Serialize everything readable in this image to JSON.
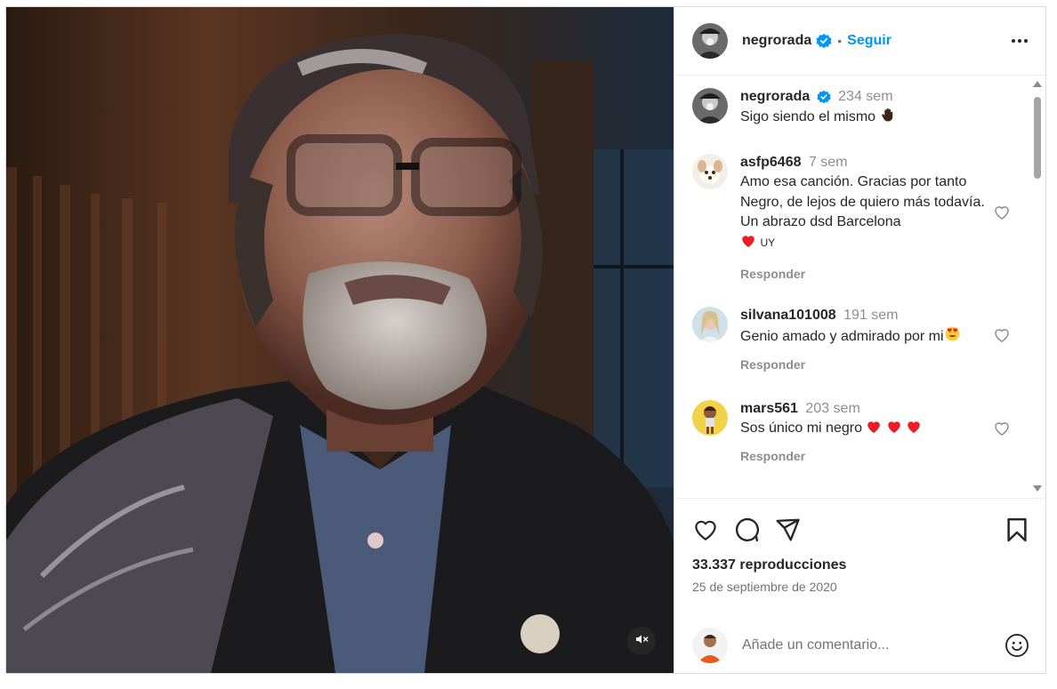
{
  "post": {
    "author": {
      "username": "negrorada",
      "verified": true,
      "follow_label": "Seguir",
      "dot": "•"
    },
    "caption": {
      "username": "negrorada",
      "time": "234 sem",
      "text": "Sigo siendo el mismo"
    },
    "comments": [
      {
        "username": "asfp6468",
        "time": "7 sem",
        "text": "Amo esa canción. Gracias por tanto Negro, de lejos de quiero más todavía. Un abrazo dsd Barcelona",
        "suffix": "UY",
        "reply_label": "Responder"
      },
      {
        "username": "silvana101008",
        "time": "191 sem",
        "text": "Genio amado y admirado por mi",
        "reply_label": "Responder"
      },
      {
        "username": "mars561",
        "time": "203 sem",
        "text": "Sos único mi negro",
        "reply_label": "Responder"
      }
    ],
    "stats": {
      "views": "33.337 reproducciones",
      "date": "25 de septiembre de 2020"
    },
    "add_comment": {
      "placeholder": "Añade un comentario..."
    },
    "icons": {
      "like": "heart-icon",
      "comment": "comment-bubble-icon",
      "share": "paper-plane-icon",
      "save": "bookmark-icon",
      "emoji": "smiley-icon",
      "mute": "speaker-muted-icon",
      "more": "more-options-icon"
    },
    "colors": {
      "follow": "#0095f6",
      "verified": "#0095f6",
      "heart": "#ed1c24",
      "secondary_text": "#8e8e8e"
    }
  }
}
